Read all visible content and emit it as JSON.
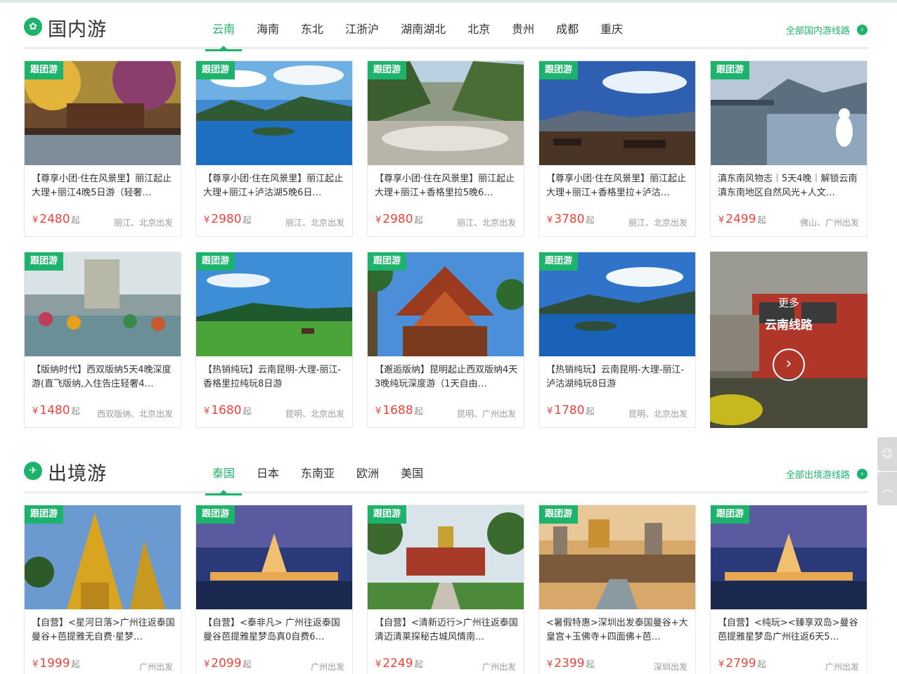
{
  "domestic": {
    "title": "国内游",
    "icon": "globe-icon",
    "tabs": [
      "云南",
      "海南",
      "东北",
      "江浙沪",
      "湖南湖北",
      "北京",
      "贵州",
      "成都",
      "重庆"
    ],
    "all_link": "全部国内游线路",
    "cards": [
      {
        "tag": "跟团游",
        "title": "【尊享小团·住在风景里】丽江起止大理+丽江4晚5日游（轻奢…",
        "price": "2480",
        "qi": "起",
        "dep": "丽江、北京出发"
      },
      {
        "tag": "跟团游",
        "title": "【尊享小团·住在风景里】丽江起止大理+丽江+泸沽湖5晚6日…",
        "price": "2980",
        "qi": "起",
        "dep": "丽江、北京出发"
      },
      {
        "tag": "跟团游",
        "title": "【尊享小团·住在风景里】丽江起止大理+丽江+香格里拉5晚6…",
        "price": "2980",
        "qi": "起",
        "dep": "丽江、北京出发"
      },
      {
        "tag": "跟团游",
        "title": "【尊享小团·住在风景里】丽江起止大理+丽江+香格里拉+泸沽…",
        "price": "3780",
        "qi": "起",
        "dep": "丽江、北京出发"
      },
      {
        "tag": "跟团游",
        "title": "滇东南风物志｜5天4晚｜解锁云南滇东南地区自然风光+人文…",
        "price": "2499",
        "qi": "起",
        "dep": "佛山、广州出发"
      },
      {
        "tag": "跟团游",
        "title": "【版纳时代】西双版纳5天4晚深度游(直飞版纳,入住告庄轻奢4…",
        "price": "1480",
        "qi": "起",
        "dep": "西双版纳、北京出发"
      },
      {
        "tag": "跟团游",
        "title": "【热销纯玩】云南昆明-大理-丽江-香格里拉纯玩8日游",
        "price": "1680",
        "qi": "起",
        "dep": "昆明、北京出发"
      },
      {
        "tag": "跟团游",
        "title": "【邂逅版纳】昆明起止西双版纳4天3晚纯玩深度游（1天自由…",
        "price": "1688",
        "qi": "起",
        "dep": "昆明、广州出发"
      },
      {
        "tag": "跟团游",
        "title": "【热销纯玩】云南昆明-大理-丽江-泸沽湖纯玩8日游",
        "price": "1780",
        "qi": "起",
        "dep": "昆明、北京出发"
      }
    ],
    "more": {
      "small": "更多",
      "big": "云南线路",
      "icon": "chevron-right-icon"
    }
  },
  "outbound": {
    "title": "出境游",
    "icon": "plane-icon",
    "tabs": [
      "泰国",
      "日本",
      "东南亚",
      "欧洲",
      "美国"
    ],
    "all_link": "全部出境游线路",
    "cards": [
      {
        "tag": "跟团游",
        "title": "【自营】<星河日落>广州往返泰国曼谷+芭提雅无自费·星梦…",
        "price": "1999",
        "qi": "起",
        "dep": "广州出发"
      },
      {
        "tag": "跟团游",
        "title": "【自营】<泰非凡> 广州往返泰国曼谷芭提雅星梦岛真0自费6…",
        "price": "2099",
        "qi": "起",
        "dep": "广州出发"
      },
      {
        "tag": "跟团游",
        "title": "【自营】<清新迈行>广州往返泰国清迈清莱探秘古城风情南…",
        "price": "2249",
        "qi": "起",
        "dep": "广州出发"
      },
      {
        "tag": "跟团游",
        "title": "<暑假特惠>深圳出发泰国曼谷+大皇宫+玉佛寺+四面佛+芭…",
        "price": "2399",
        "qi": "起",
        "dep": "深圳出发"
      },
      {
        "tag": "跟团游",
        "title": "【自营】<纯玩><臻享双岛>曼谷芭提雅星梦岛广州往返6天5…",
        "price": "2799",
        "qi": "起",
        "dep": "广州出发"
      }
    ]
  },
  "currency": "¥",
  "side_tools": {
    "chat": "chat-icon",
    "top": "back-to-top-icon"
  }
}
